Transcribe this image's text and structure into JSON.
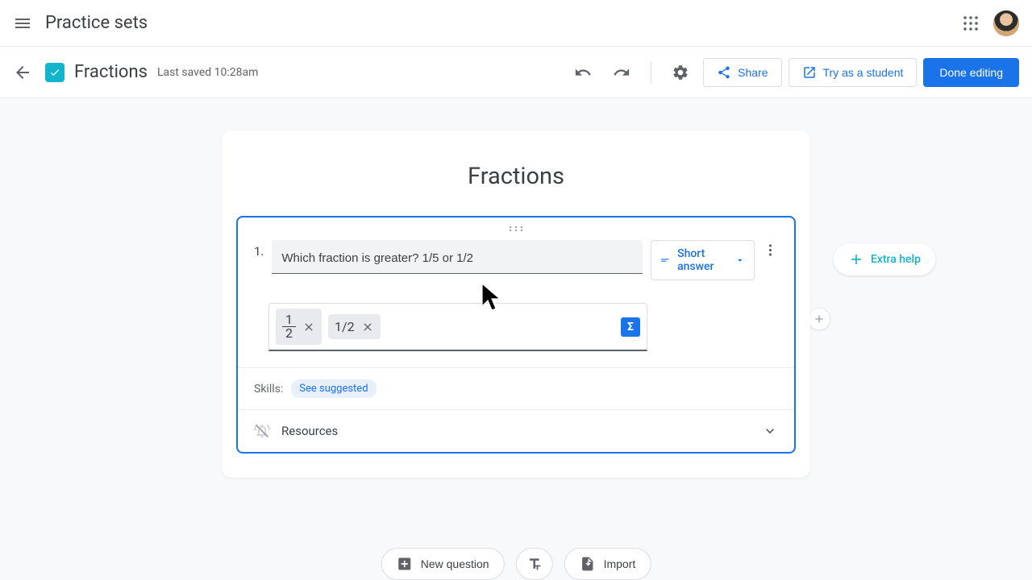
{
  "header": {
    "app_title": "Practice sets"
  },
  "doc": {
    "title": "Fractions",
    "save_status": "Last saved 10:28am",
    "share_label": "Share",
    "try_student_label": "Try as a student",
    "done_editing_label": "Done editing"
  },
  "extra_help": {
    "label": "Extra help"
  },
  "practice_set": {
    "title": "Fractions"
  },
  "question": {
    "number": "1.",
    "text": "Which fraction is greater? 1/5 or 1/2",
    "type_label": "Short answer",
    "answers": [
      {
        "numerator": "1",
        "denominator": "2"
      },
      {
        "text": "1/2"
      }
    ]
  },
  "skills": {
    "label": "Skills:",
    "suggested_label": "See suggested"
  },
  "resources": {
    "label": "Resources"
  },
  "bottom": {
    "new_question": "New question",
    "import": "Import"
  }
}
